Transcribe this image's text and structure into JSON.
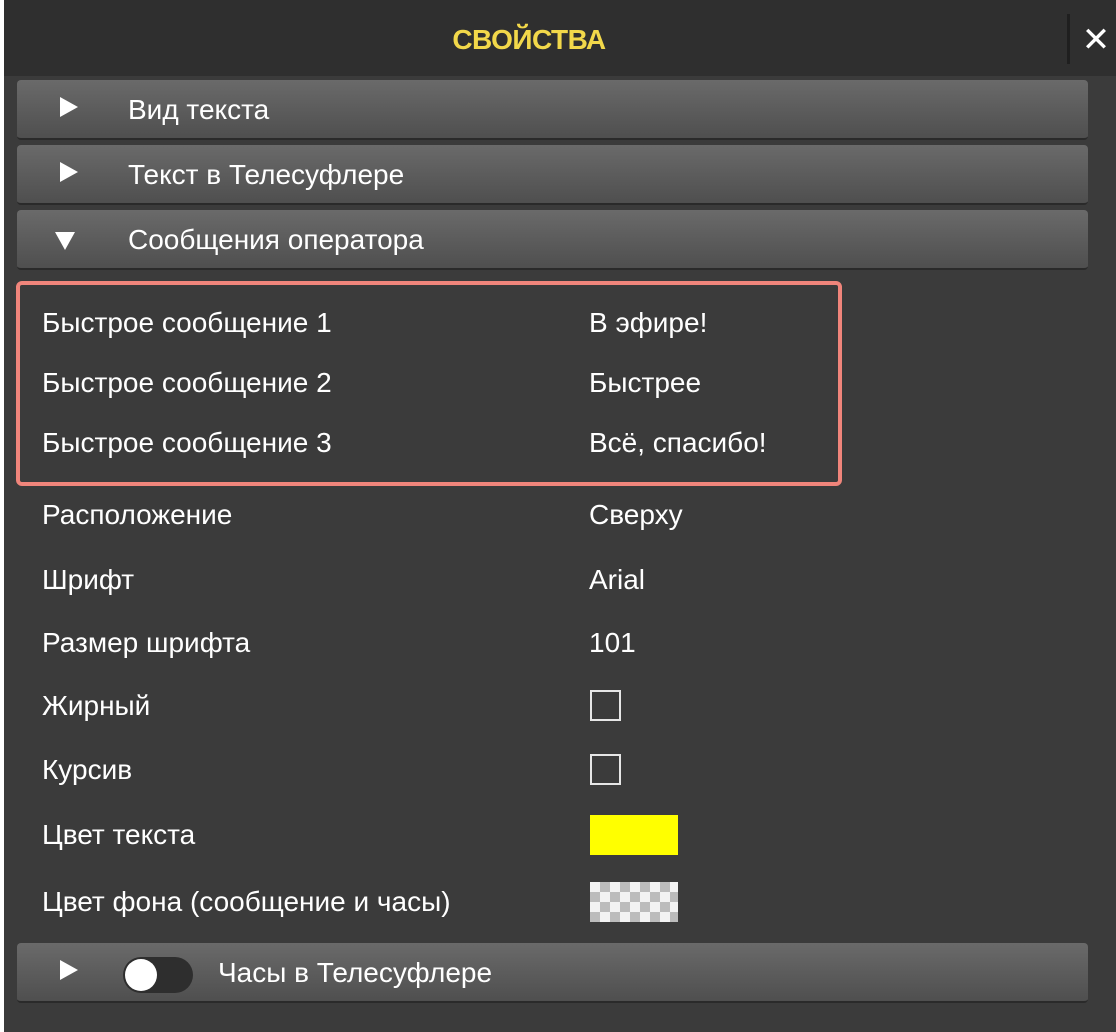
{
  "panel": {
    "title": "СВОЙСТВА",
    "close_glyph": "✕",
    "accent_color": "#f2d84a",
    "highlight_color": "#f0857b"
  },
  "sections": [
    {
      "label": "Вид текста",
      "state": "collapsed"
    },
    {
      "label": "Текст в Телесуфлере",
      "state": "collapsed"
    },
    {
      "label": "Сообщения оператора",
      "state": "expanded"
    },
    {
      "label": "Часы в Телесуфлере",
      "state": "collapsed",
      "toggle": "off"
    }
  ],
  "properties": {
    "msg1": {
      "name": "Быстрое сообщение 1",
      "value": "В эфире!"
    },
    "msg2": {
      "name": "Быстрое сообщение 2",
      "value": "Быстрее"
    },
    "msg3": {
      "name": "Быстрое сообщение 3",
      "value": "Всё, спасибо!"
    },
    "position": {
      "name": "Расположение",
      "value": "Сверху"
    },
    "font": {
      "name": "Шрифт",
      "value": "Arial"
    },
    "font_size": {
      "name": "Размер шрифта",
      "value": "101"
    },
    "bold": {
      "name": "Жирный",
      "checked": false
    },
    "italic": {
      "name": "Курсив",
      "checked": false
    },
    "text_color": {
      "name": "Цвет текста",
      "color": "#ffff00"
    },
    "bg_color": {
      "name": "Цвет фона (сообщение и часы)",
      "color": "transparent"
    }
  }
}
